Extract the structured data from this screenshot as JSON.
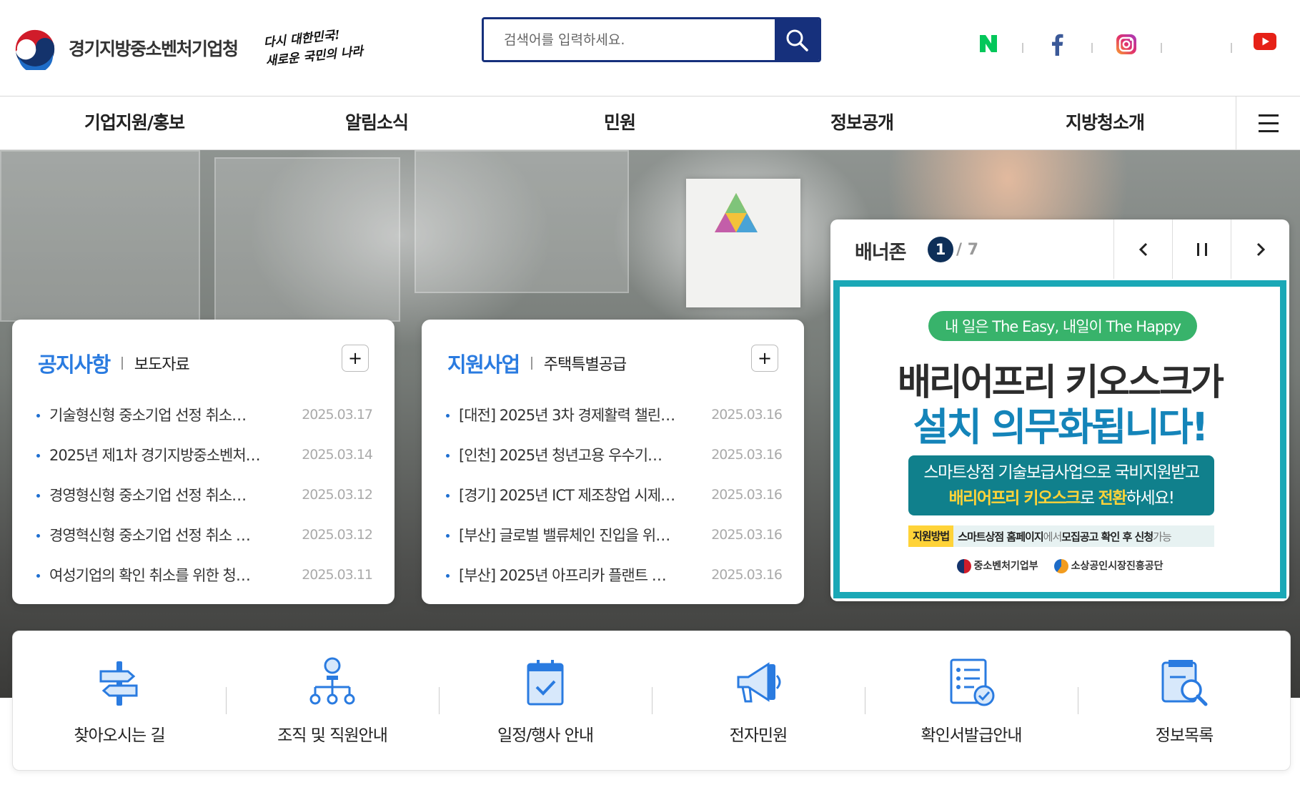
{
  "header": {
    "org_name": "경기지방중소벤처기업청",
    "slogan_line1": "다시 대한민국!",
    "slogan_line2": "새로운 국민의 나라",
    "search_placeholder": "검색어를 입력하세요.",
    "sns": [
      {
        "icon": "naver-blog-icon",
        "glyph": "N",
        "color": "#03c75a"
      },
      {
        "icon": "facebook-icon",
        "glyph": "f",
        "color": "#3b5998"
      },
      {
        "icon": "instagram-icon",
        "glyph": "",
        "color": "#e1306c"
      },
      {
        "icon": "youtube-icon",
        "glyph": "",
        "color": "#e62117"
      }
    ]
  },
  "nav": {
    "items": [
      "기업지원/홍보",
      "알림소식",
      "민원",
      "정보공개",
      "지방청소개"
    ],
    "menu_icon": "hamburger-menu-icon"
  },
  "notice_card": {
    "title": "공지사항",
    "sub": "보도자료",
    "items": [
      {
        "title": "기술형신형 중소기업 선정 취소…",
        "date": "2025.03.17"
      },
      {
        "title": "2025년 제1차 경기지방중소벤처…",
        "date": "2025.03.14"
      },
      {
        "title": "경영형신형 중소기업 선정 취소…",
        "date": "2025.03.12"
      },
      {
        "title": "경영혁신형 중소기업 선정 취소 …",
        "date": "2025.03.12"
      },
      {
        "title": "여성기업의 확인 취소를 위한 청…",
        "date": "2025.03.11"
      }
    ]
  },
  "support_card": {
    "title": "지원사업",
    "sub": "주택특별공급",
    "items": [
      {
        "title": "[대전] 2025년 3차 경제활력 챌린…",
        "date": "2025.03.16"
      },
      {
        "title": "[인천] 2025년 청년고용 우수기…",
        "date": "2025.03.16"
      },
      {
        "title": "[경기] 2025년 ICT 제조창업 시제…",
        "date": "2025.03.16"
      },
      {
        "title": "[부산] 글로벌 밸류체인 진입을 위…",
        "date": "2025.03.16"
      },
      {
        "title": "[부산] 2025년 아프리카 플랜트 …",
        "date": "2025.03.16"
      }
    ]
  },
  "banner_zone": {
    "title": "배너존",
    "current": "1",
    "total": "/ 7",
    "banner": {
      "pill": "내 일은 The Easy, 내일이 The Happy",
      "headline1": "배리어프리 키오스크가",
      "headline2": "설치 의무화됩니다!",
      "box_line1": "스마트상점 기술보급사업으로 국비지원받고",
      "box_line2_highlight": "배리어프리 키오스크",
      "box_line2_mid": "로 ",
      "box_line2_highlight2": "전환",
      "box_line2_end": "하세요!",
      "method_tag": "지원방법",
      "method_b1": "스마트상점 홈페이지",
      "method_t1": "에서 ",
      "method_b2": "모집공고 확인 후 신청",
      "method_t2": " 가능",
      "logo1": "중소벤처기업부",
      "logo2": "소상공인시장진흥공단"
    }
  },
  "quick_links": [
    {
      "label": "찾아오시는 길",
      "icon": "signpost-icon"
    },
    {
      "label": "조직 및 직원안내",
      "icon": "org-chart-icon"
    },
    {
      "label": "일정/행사 안내",
      "icon": "calendar-check-icon"
    },
    {
      "label": "전자민원",
      "icon": "megaphone-icon"
    },
    {
      "label": "확인서발급안내",
      "icon": "document-check-icon"
    },
    {
      "label": "정보목록",
      "icon": "search-book-icon"
    }
  ],
  "colors": {
    "brand_navy": "#16307c",
    "accent_blue": "#2a7be0",
    "banner_teal": "#1aa8b6"
  }
}
